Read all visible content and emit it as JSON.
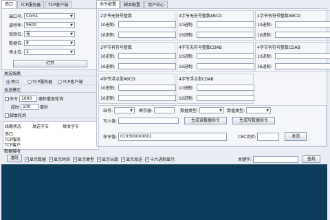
{
  "left_tabs": [
    "串口",
    "TCP服务器",
    "TCP客户端"
  ],
  "serial": {
    "port_label": "端口号:",
    "port_value": "Com1",
    "baud_label": "波特率:",
    "baud_value": "9600",
    "parity_label": "效验位:",
    "parity_value": "无",
    "databits_label": "数据位:",
    "databits_value": "8",
    "stopbits_label": "停止位:",
    "stopbits_value": "1",
    "open_button": "打开"
  },
  "send_line": {
    "title": "发送线路",
    "options": [
      "串口",
      "TCP服务器",
      "TCP客户端"
    ]
  },
  "send_mode": {
    "title": "发送模式",
    "command_label": "命令",
    "command_value": "1000",
    "command_unit": "毫秒重复轮询",
    "timeout_label": "超时",
    "timeout_value": "100",
    "timeout_unit": "毫秒",
    "script_label": "脚本轮询"
  },
  "line_status": {
    "headers": [
      "线路状态",
      "发送字节",
      "接收字节"
    ],
    "rows": [
      "串口",
      "TCP服务",
      "TCP客户"
    ]
  },
  "right_tabs": [
    "命令配置",
    "脚本配置",
    "用户中心"
  ],
  "conversions": {
    "dec_label": "10进制:",
    "hex_label": "16进制:",
    "boxes": [
      {
        "title": "2字节无符号整数"
      },
      {
        "title": "4字节无符号整数ABCD"
      },
      {
        "title": "4字节有符号整数ABCD"
      },
      {
        "title": "2字节有符号整数"
      },
      {
        "title": "4字节无符号整数CDAB"
      },
      {
        "title": "4字节有符号整数CDAB"
      },
      {
        "title": "4字节浮点型ABCD"
      },
      {
        "title": "4字节浮点型CDAB"
      }
    ]
  },
  "command": {
    "station_label": "站号:",
    "register_label": "寄存器:",
    "datatype_label": "数据类型:",
    "datavalue_label": "数值类型:",
    "write_label": "写入值:",
    "read_button": "生成读数据命令",
    "write_button": "生成写数据命令",
    "cmd_label": "命令值:",
    "cmd_value": "010300000001",
    "crc_label": "CRC功验:",
    "send_button": "发送"
  },
  "receive": {
    "section_label": "数据接收",
    "clear_button": "清除",
    "options": [
      {
        "label": "显示数据",
        "checked": true
      },
      {
        "label": "显示时间",
        "checked": true
      },
      {
        "label": "显示类型",
        "checked": true
      },
      {
        "label": "显示长度",
        "checked": true
      },
      {
        "label": "显示发送",
        "checked": true
      },
      {
        "label": "十六进制显示",
        "checked": true
      }
    ],
    "keyword_label": "关键字:",
    "search_button": "查找"
  }
}
